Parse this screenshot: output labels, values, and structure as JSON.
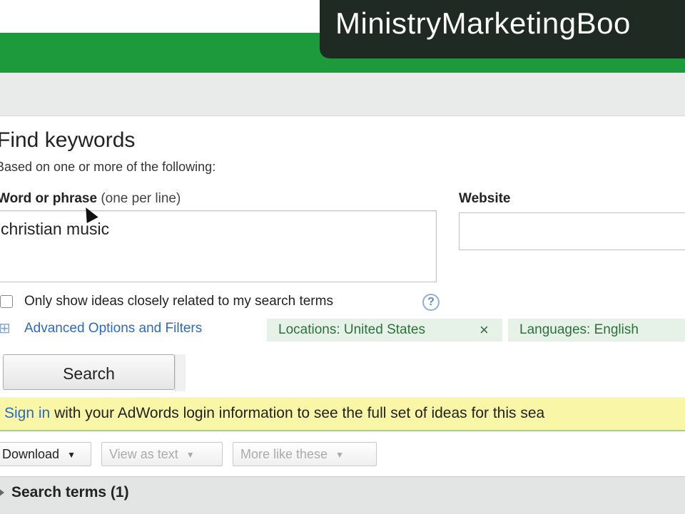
{
  "watermark": {
    "text": "MinistryMarketingBoo"
  },
  "find": {
    "title": "Find keywords",
    "subtitle": "Based on one or more of the following:",
    "phrase_label_bold": "Word or phrase",
    "phrase_label_hint": "(one per line)",
    "phrase_value": "christian music",
    "website_label": "Website",
    "website_value": ""
  },
  "options": {
    "closely_related_label": "Only show ideas closely related to my search terms",
    "help_icon": "?",
    "expand_icon": "⊞",
    "advanced_link": "Advanced Options and Filters",
    "locations_chip": "Locations: United States",
    "remove_icon": "×",
    "languages_chip": "Languages: English"
  },
  "search_button": {
    "label": "Search"
  },
  "signin": {
    "link": "Sign in",
    "text": "with your AdWords login information to see the full set of ideas for this sea"
  },
  "toolbar": {
    "download": "Download",
    "view_as_text": "View as text",
    "more_like_these": "More like these",
    "caret": "▼"
  },
  "results": {
    "search_terms_label": "Search terms (1)"
  },
  "colors": {
    "green_band": "#1d9a3c",
    "link": "#2a6ac2",
    "signin_bg": "#f9f6a8",
    "chip_bg": "#e6f2e8"
  }
}
